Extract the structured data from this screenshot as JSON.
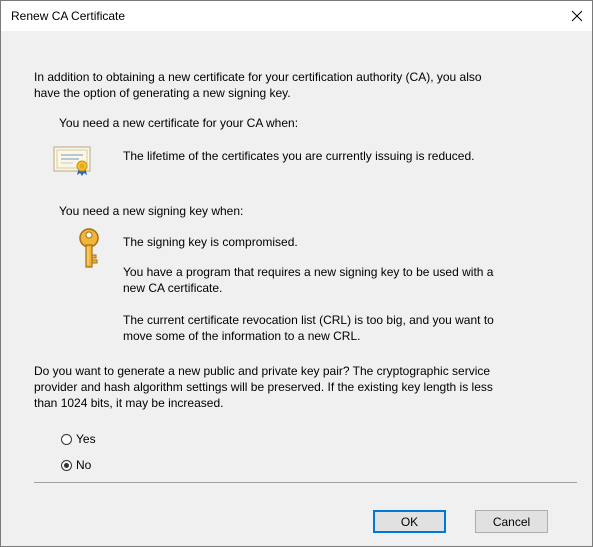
{
  "window": {
    "title": "Renew CA Certificate",
    "close_icon": "close-icon"
  },
  "intro": {
    "line1": "In addition to obtaining a new certificate for your certification authority (CA), you also",
    "line2": "have the option of generating a new signing key."
  },
  "cert_section": {
    "heading": "You need a new certificate for your CA when:",
    "icon": "certificate-icon",
    "reason1": "The lifetime of the certificates you are currently issuing is reduced."
  },
  "key_section": {
    "heading": "You need a new signing key when:",
    "icon": "key-icon",
    "reason1": "The signing key is compromised.",
    "reason2_line1": "You have a program that requires a new signing key to be used with a",
    "reason2_line2": "new CA certificate.",
    "reason3_line1": "The current certificate revocation list (CRL) is too big, and you want to",
    "reason3_line2": "move some of the information to a new CRL."
  },
  "question": {
    "line1": "Do you want to generate a new public and private key pair? The cryptographic service",
    "line2": "provider and hash algorithm settings will be preserved.  If the existing key length is less",
    "line3": "than 1024 bits, it may be increased."
  },
  "options": {
    "yes_label": "Yes",
    "no_label": "No",
    "selected": "No"
  },
  "buttons": {
    "ok_label": "OK",
    "cancel_label": "Cancel"
  },
  "colors": {
    "accent": "#0078d7",
    "client_bg": "#f0f0f0",
    "button_bg": "#e1e1e1"
  }
}
